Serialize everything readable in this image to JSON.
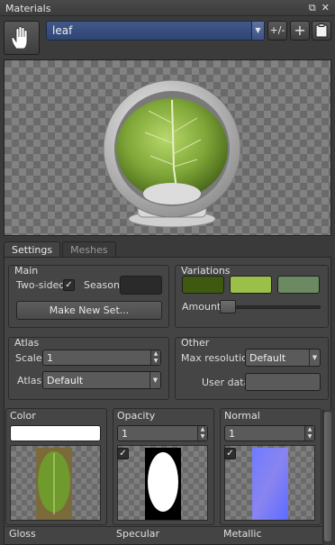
{
  "window": {
    "title": "Materials",
    "restore_icon": "restore-icon",
    "close_icon": "close-icon"
  },
  "toolbar": {
    "material_value": "leaf",
    "plusminus_label": "+/-",
    "add_icon": "add-material-icon",
    "paste_icon": "clipboard-icon"
  },
  "tabs": [
    {
      "label": "Settings",
      "active": true
    },
    {
      "label": "Meshes",
      "active": false
    }
  ],
  "main": {
    "title": "Main",
    "two_sided_label": "Two-sided",
    "two_sided_checked": true,
    "season_label": "Season",
    "make_new_set_label": "Make New Set..."
  },
  "variations": {
    "title": "Variations",
    "colors": [
      "#3f5a10",
      "#9bc04a",
      "#6b8a64"
    ],
    "amount_label": "Amount",
    "amount_value": 0
  },
  "atlas": {
    "title": "Atlas",
    "scale_label": "Scale",
    "scale_value": "1",
    "atlas_label": "Atlas",
    "atlas_value": "Default"
  },
  "other": {
    "title": "Other",
    "max_resolution_label": "Max resolution",
    "max_resolution_value": "Default",
    "user_data_label": "User data"
  },
  "slots": [
    {
      "title": "Color",
      "value": "",
      "checked": true
    },
    {
      "title": "Opacity",
      "value": "1",
      "checked": true
    },
    {
      "title": "Normal",
      "value": "1",
      "checked": true
    }
  ],
  "bottom_slots": [
    "Gloss",
    "Specular",
    "Metallic"
  ]
}
